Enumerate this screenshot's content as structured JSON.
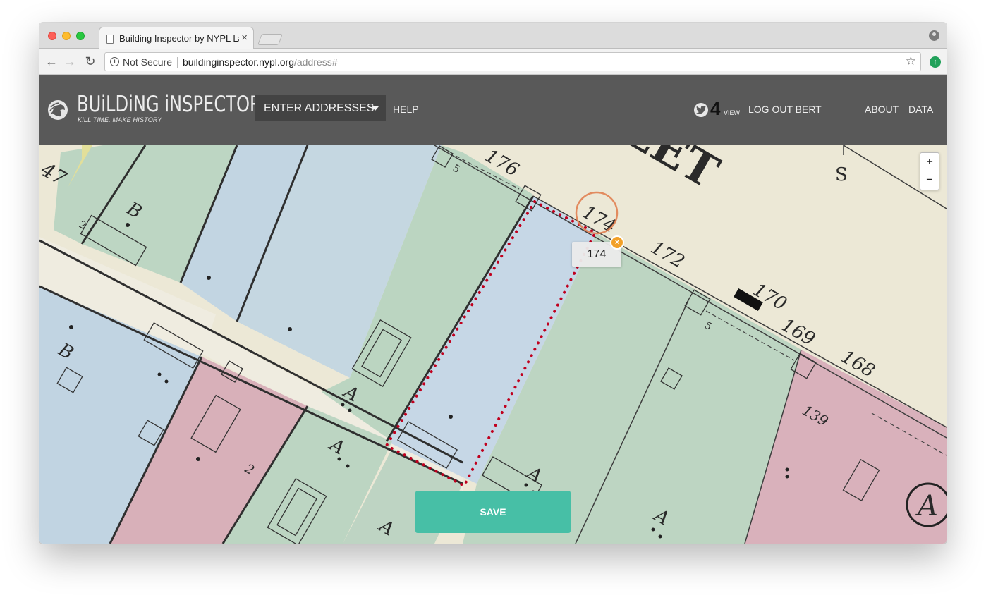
{
  "browser": {
    "tab_title": "Building Inspector by NYPL La",
    "security_label": "Not Secure",
    "url_host": "buildinginspector.nypl.org",
    "url_path": "/address#"
  },
  "header": {
    "logo_title": "BUiLDiNG iNSPECTOR",
    "logo_tagline": "KILL TIME. MAKE HISTORY.",
    "menu_label": "ENTER ADDRESSES",
    "help_label": "HELP",
    "score_value": "4",
    "score_unit": "VIEW",
    "logout_label": "LOG OUT BERT",
    "about_label": "ABOUT",
    "data_label": "DATA"
  },
  "map": {
    "zoom_in": "+",
    "zoom_out": "−",
    "address_label": "174",
    "remove_glyph": "×",
    "save_label": "SAVE"
  },
  "map_text": {
    "street": "EET",
    "s": "S",
    "n47": "47",
    "n176": "176",
    "n174": "174",
    "n172": "172",
    "n170": "170",
    "n169": "169",
    "n168": "168",
    "n139": "139",
    "n5a": "5",
    "n5b": "5",
    "n2a": "2",
    "n2b": "2",
    "bA": "B",
    "bB": "B",
    "aA": "A",
    "aB": "A",
    "aC": "A",
    "aD": "A",
    "aE": "A",
    "aF": "A"
  },
  "colors": {
    "header_bg": "#595959",
    "save_button": "#47bfa6",
    "parcel_outline": "#c0001e",
    "blue_parcel": "#c5d6e3",
    "green_parcel": "#bcd6c4",
    "pink_parcel": "#dbb2ba"
  }
}
